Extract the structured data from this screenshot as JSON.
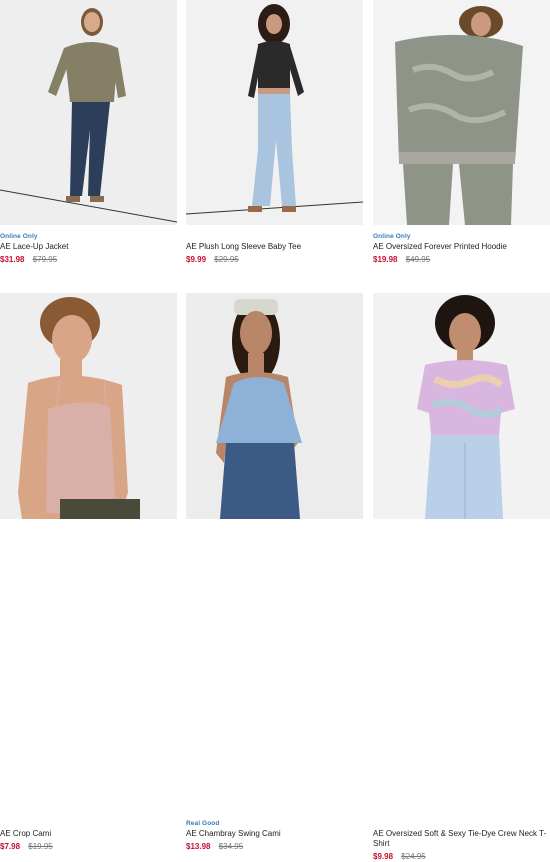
{
  "products": [
    {
      "badge": "Online Only",
      "name": "AE Lace-Up Jacket",
      "sale_price": "$31.98",
      "original_price": "$79.95",
      "palette": {
        "bg": "#eeeeee",
        "top": "#857f66",
        "bottom": "#2c3e5a",
        "skin": "#d9a98b",
        "hair": "#7a5a3a"
      }
    },
    {
      "badge": "",
      "name": "AE Plush Long Sleeve Baby Tee",
      "sale_price": "$9.99",
      "original_price": "$29.95",
      "palette": {
        "bg": "#f1f1f1",
        "top": "#2a2a2a",
        "bottom": "#a9c4de",
        "skin": "#c99a80",
        "hair": "#2b1d15"
      }
    },
    {
      "badge": "Online Only",
      "name": "AE Oversized Forever Printed Hoodie",
      "sale_price": "$19.98",
      "original_price": "$49.95",
      "palette": {
        "bg": "#f3f3f3",
        "top": "#8e9488",
        "bottom": "#8e9488",
        "skin": "#c99a80",
        "hair": "#6b4a2a"
      }
    },
    {
      "badge": "",
      "name": "AE Crop Cami",
      "sale_price": "$7.98",
      "original_price": "$19.95",
      "palette": {
        "bg": "#eeeeee",
        "top": "#d9b0a8",
        "bottom": "#4a4a3a",
        "skin": "#d8a586",
        "hair": "#8a5a34"
      }
    },
    {
      "badge": "Real Good",
      "name": "AE Chambray Swing Cami",
      "sale_price": "$13.98",
      "original_price": "$34.95",
      "palette": {
        "bg": "#ececec",
        "top": "#8eb1d8",
        "bottom": "#3b5a85",
        "skin": "#b98568",
        "hair": "#2a1a10"
      }
    },
    {
      "badge": "",
      "name": "AE Oversized Soft & Sexy Tie-Dye Crew Neck T-Shirt",
      "sale_price": "$9.98",
      "original_price": "$24.95",
      "palette": {
        "bg": "#f2f2f2",
        "top": "#d8b6e0",
        "bottom": "#b9d0e8",
        "skin": "#c18d6f",
        "hair": "#1e1510"
      }
    }
  ]
}
